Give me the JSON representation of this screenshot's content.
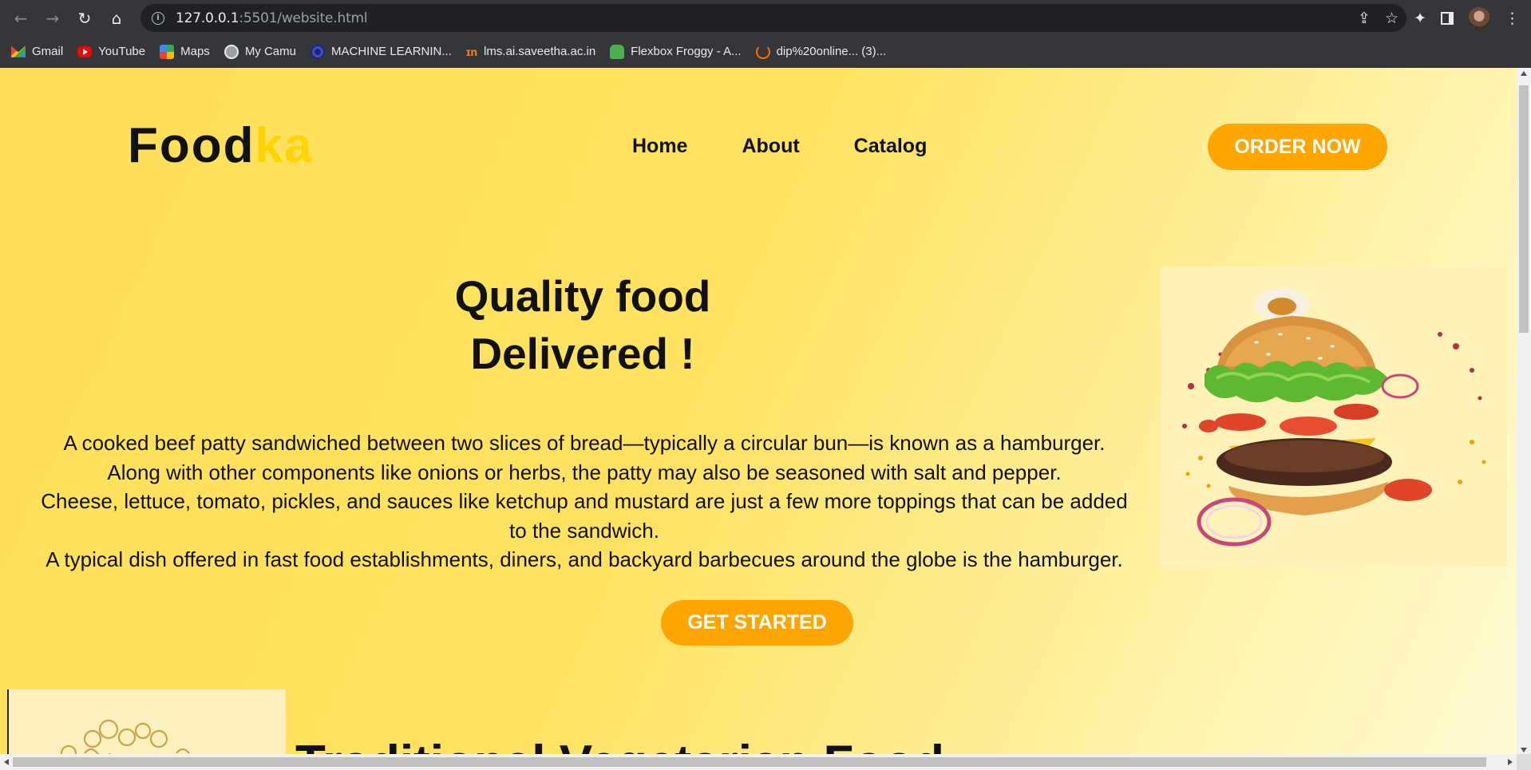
{
  "browser": {
    "url_host": "127.0.0.1",
    "url_rest": ":5501/website.html",
    "bookmarks": [
      {
        "label": "Gmail",
        "icon": "gmail-icon"
      },
      {
        "label": "YouTube",
        "icon": "youtube-icon"
      },
      {
        "label": "Maps",
        "icon": "maps-icon"
      },
      {
        "label": "My Camu",
        "icon": "globe-icon"
      },
      {
        "label": "MACHINE LEARNIN...",
        "icon": "ml-icon"
      },
      {
        "label": "lms.ai.saveetha.ac.in",
        "icon": "lms-icon"
      },
      {
        "label": "Flexbox Froggy - A...",
        "icon": "froggy-icon"
      },
      {
        "label": "dip%20online... (3)...",
        "icon": "loading-icon"
      }
    ]
  },
  "site": {
    "logo_main": "Food",
    "logo_accent": "ka",
    "nav": [
      "Home",
      "About",
      "Catalog"
    ],
    "order_button": "ORDER NOW",
    "hero_title": [
      "Quality food",
      "Delivered !"
    ],
    "hero_text": [
      "A cooked beef patty sandwiched between two slices of bread—typically a circular bun—is known as a hamburger.",
      "Along with other components like onions or herbs, the patty may also be seasoned with salt and pepper.",
      "Cheese, lettuce, tomato, pickles, and sauces like ketchup and mustard are just a few more toppings that can be added",
      "to the sandwich.",
      "A typical dish offered in fast food establishments, diners, and backyard barbecues around the globe is the hamburger."
    ],
    "start_button": "GET STARTED",
    "next_section_heading": "Traditional Vegetarian Food"
  },
  "colors": {
    "accent": "#ffa500",
    "logo_accent": "#ffd400",
    "background_start": "#ffe05a",
    "background_end": "#fffbd6"
  }
}
